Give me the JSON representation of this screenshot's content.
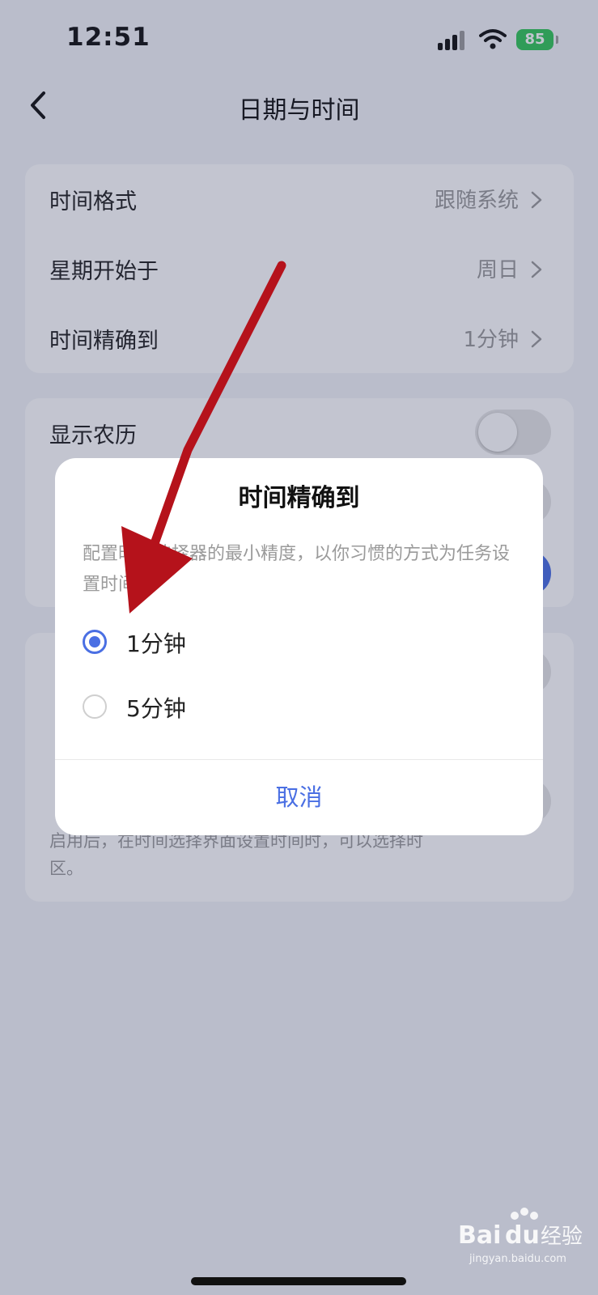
{
  "status_bar": {
    "time": "12:51",
    "battery": "85"
  },
  "nav": {
    "title": "日期与时间"
  },
  "card1": {
    "rows": [
      {
        "label": "时间格式",
        "value": "跟随系统"
      },
      {
        "label": "星期开始于",
        "value": "周日"
      },
      {
        "label": "时间精确到",
        "value": "1分钟"
      }
    ]
  },
  "card2": {
    "rows": [
      {
        "label": "显示农历"
      }
    ]
  },
  "card3": {
    "desc_line_1": "启用后，在时间选择界面设置时间时，可以选择时",
    "desc_line_2": "区。"
  },
  "dialog": {
    "title": "时间精确到",
    "description": "配置时间选择器的最小精度，以你习惯的方式为任务设置时间。",
    "options": [
      {
        "label": "1分钟",
        "selected": true
      },
      {
        "label": "5分钟",
        "selected": false
      }
    ],
    "cancel_label": "取消"
  },
  "colors": {
    "accent": "#4a6fe3",
    "arrow": "#b5121b",
    "battery": "#34c759"
  },
  "watermark": {
    "brand": "Baidu经验",
    "url": "jingyan.baidu.com"
  }
}
